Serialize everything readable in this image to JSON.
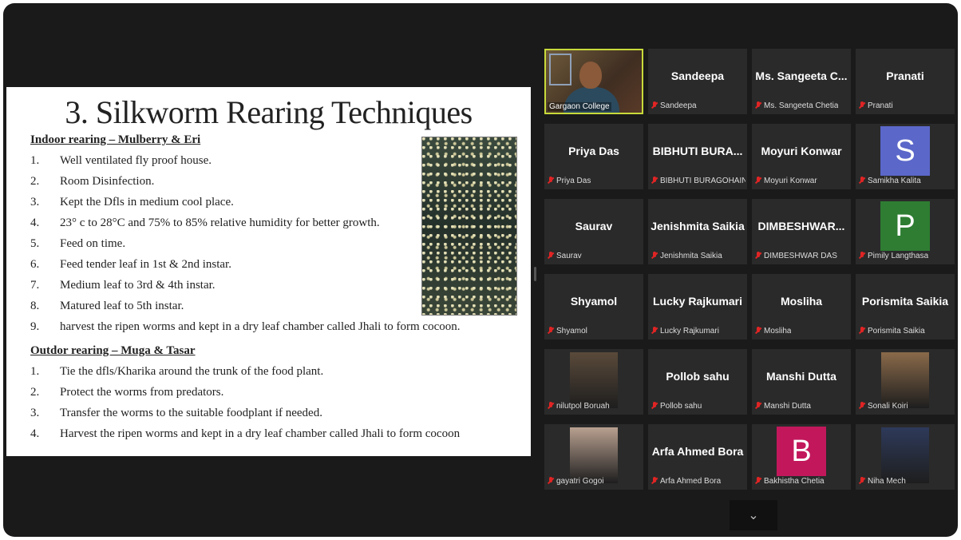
{
  "slide": {
    "title": "3. Silkworm Rearing Techniques",
    "indoor_heading": "Indoor rearing – Mulberry & Eri",
    "indoor_items": [
      {
        "n": "1.",
        "t": "Well ventilated fly proof house."
      },
      {
        "n": "2.",
        "t": "Room Disinfection."
      },
      {
        "n": "3.",
        "t": "Kept the Dfls in medium cool place."
      },
      {
        "n": "4.",
        "t": "23° c to 28°C and 75% to 85% relative humidity  for better growth."
      },
      {
        "n": "5.",
        "t": "Feed on time."
      },
      {
        "n": "6.",
        "t": "Feed tender leaf in 1st & 2nd instar."
      },
      {
        "n": "7.",
        "t": "Medium leaf to 3rd & 4th instar."
      },
      {
        "n": "8.",
        "t": "Matured leaf to 5th instar."
      },
      {
        "n": "9.",
        "t": "harvest the ripen worms and kept in a dry leaf chamber called Jhali to form cocoon."
      }
    ],
    "outdoor_heading": "Outdor rearing – Muga & Tasar",
    "outdoor_items": [
      {
        "n": "1.",
        "t": "Tie the dfls/Kharika around the trunk of the food plant."
      },
      {
        "n": "2.",
        "t": "Protect the worms from predators."
      },
      {
        "n": "3.",
        "t": "Transfer the worms to the suitable foodplant if needed."
      },
      {
        "n": "4.",
        "t": "Harvest the ripen worms and kept in a dry leaf chamber called Jhali to form cocoon"
      }
    ]
  },
  "participants": [
    {
      "display": "",
      "label": "Gargaon College",
      "kind": "camera"
    },
    {
      "display": "Sandeepa",
      "label": "Sandeepa",
      "kind": "name"
    },
    {
      "display": "Ms. Sangeeta C...",
      "label": "Ms. Sangeeta Chetia",
      "kind": "name"
    },
    {
      "display": "Pranati",
      "label": "Pranati",
      "kind": "name"
    },
    {
      "display": "Priya Das",
      "label": "Priya Das",
      "kind": "name"
    },
    {
      "display": "BIBHUTI BURA...",
      "label": "BIBHUTI BURAGOHAIN",
      "kind": "name"
    },
    {
      "display": "Moyuri Konwar",
      "label": "Moyuri Konwar",
      "kind": "name"
    },
    {
      "display": "S",
      "label": "Samikha Kalita",
      "kind": "avatar",
      "color": "#5b67c9"
    },
    {
      "display": "Saurav",
      "label": "Saurav",
      "kind": "name"
    },
    {
      "display": "Jenishmita Saikia",
      "label": "Jenishmita Saikia",
      "kind": "name"
    },
    {
      "display": "DIMBESHWAR...",
      "label": "DIMBESHWAR DAS",
      "kind": "name"
    },
    {
      "display": "P",
      "label": "Pimily Langthasa",
      "kind": "avatar",
      "color": "#2e7d32"
    },
    {
      "display": "Shyamol",
      "label": "Shyamol",
      "kind": "name"
    },
    {
      "display": "Lucky Rajkumari",
      "label": "Lucky Rajkumari",
      "kind": "name"
    },
    {
      "display": "Mosliha",
      "label": "Mosliha",
      "kind": "name"
    },
    {
      "display": "Porismita Saikia",
      "label": "Porismita Saikia",
      "kind": "name"
    },
    {
      "display": "",
      "label": "nilutpol Boruah",
      "kind": "photo",
      "color": "#5a4a3a"
    },
    {
      "display": "Pollob sahu",
      "label": "Pollob sahu",
      "kind": "name"
    },
    {
      "display": "Manshi Dutta",
      "label": "Manshi Dutta",
      "kind": "name"
    },
    {
      "display": "",
      "label": "Sonali Koiri",
      "kind": "photo",
      "color": "#8a6a4a"
    },
    {
      "display": "",
      "label": "gayatri Gogoi",
      "kind": "photo",
      "color": "#b8a090"
    },
    {
      "display": "Arfa Ahmed Bora",
      "label": "Arfa Ahmed Bora",
      "kind": "name"
    },
    {
      "display": "B",
      "label": "Bakhistha Chetia",
      "kind": "avatar",
      "color": "#c2185b"
    },
    {
      "display": "",
      "label": "Niha Mech",
      "kind": "photo",
      "color": "#2e3a5a"
    }
  ],
  "controls": {
    "expand_icon": "chevron-down-icon",
    "expand_glyph": "⌄"
  }
}
